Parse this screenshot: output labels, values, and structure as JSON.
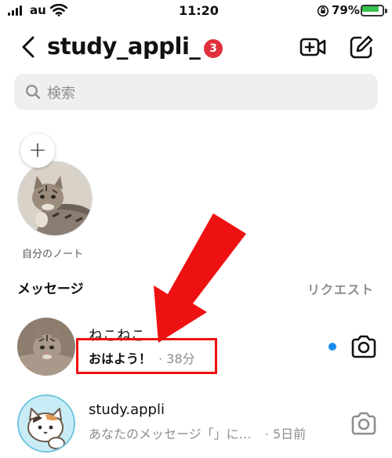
{
  "status_bar": {
    "carrier": "au",
    "time": "11:20",
    "battery_percent": "79%",
    "battery_level": 0.79,
    "icons": [
      "signal-icon",
      "wifi-icon",
      "orientation-lock-icon",
      "battery-icon"
    ]
  },
  "header": {
    "title": "study_appli_",
    "badge_count": "3",
    "icons": [
      "back-chevron-icon",
      "video-call-icon",
      "compose-icon"
    ]
  },
  "search": {
    "placeholder": "検索"
  },
  "note": {
    "label": "自分のノート",
    "add_symbol": "+"
  },
  "messages_section": {
    "title": "メッセージ",
    "requests_label": "リクエスト"
  },
  "conversations": [
    {
      "name": "ねこねこ",
      "last_message": "おはよう！",
      "time": "· 38分",
      "unread": true,
      "unread_color": "#1a8cf0"
    },
    {
      "name": "study.appli",
      "last_message": "あなたのメッセージ「」に…",
      "time": "· 5日前",
      "unread": false
    }
  ],
  "annotation": {
    "arrow_color": "#ee1111",
    "box_color": "#ee1111"
  }
}
